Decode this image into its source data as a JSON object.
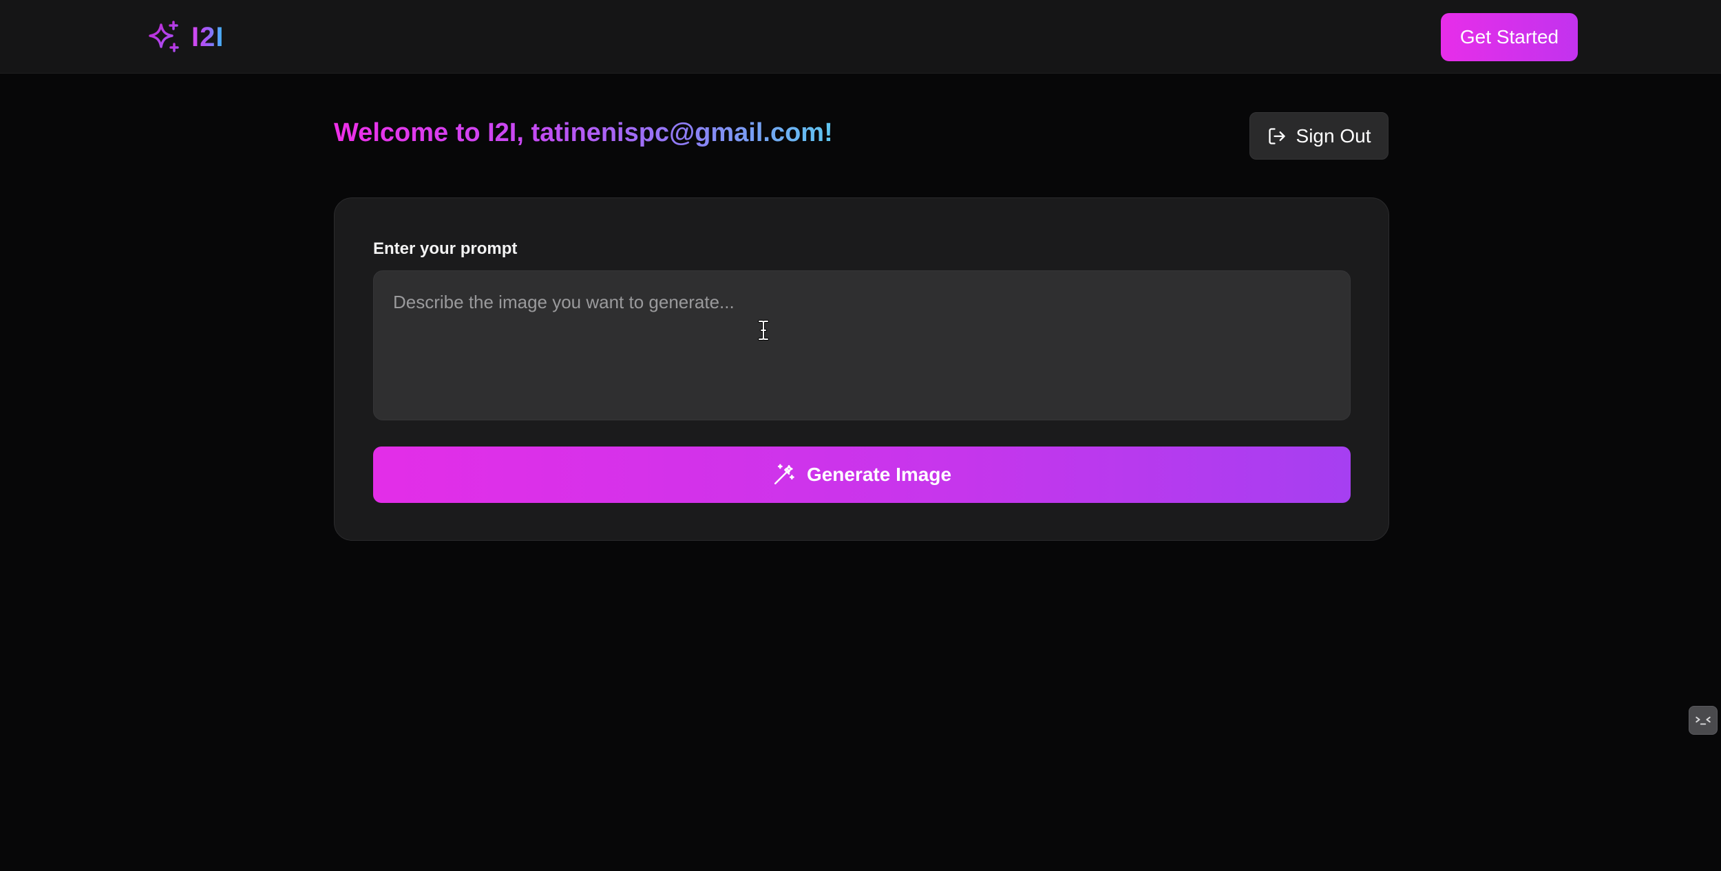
{
  "navbar": {
    "brand_name": "I2I",
    "get_started_label": "Get Started"
  },
  "welcome": {
    "heading": "Welcome to I2I, tatinenispc@gmail.com!",
    "sign_out_label": "Sign Out"
  },
  "prompt_form": {
    "label": "Enter your prompt",
    "value": "",
    "placeholder": "Describe the image you want to generate...",
    "generate_label": "Generate Image"
  },
  "icons": {
    "brand": "sparkles-icon",
    "sign_out": "log-out-icon",
    "generate": "magic-wand-icon",
    "side_widget": "collapse-icon"
  },
  "colors": {
    "background": "#070708",
    "navbar": "#151516",
    "card": "#1b1b1c",
    "input": "#2f2f30",
    "accent_pink": "#e72ee9",
    "accent_purple": "#a855f7",
    "accent_cyan": "#38bdf8"
  }
}
